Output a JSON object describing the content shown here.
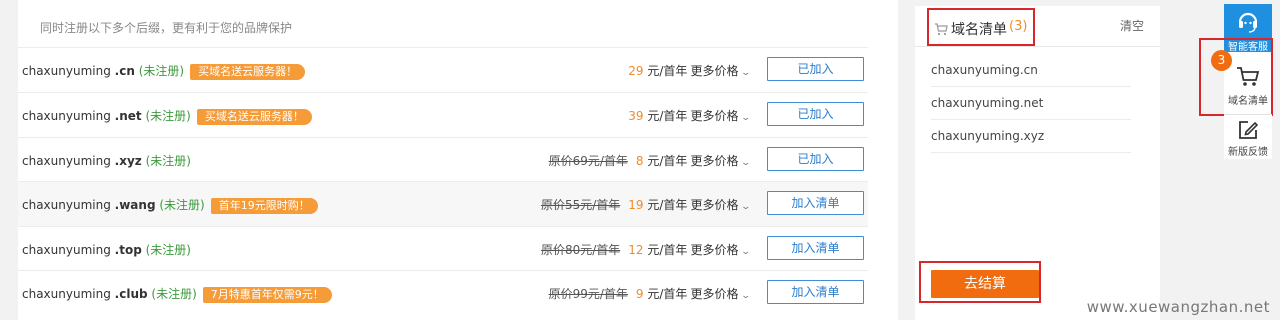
{
  "hint": "同时注册以下多个后缀，更有利于您的品牌保护",
  "rows": [
    {
      "name": "chaxunyuming",
      "ext": ".cn",
      "status": "(未注册)",
      "promo": "买域名送云服务器！",
      "orig": "",
      "price": "29",
      "unit": "元/首年",
      "more": "更多价格",
      "button": "已加入"
    },
    {
      "name": "chaxunyuming",
      "ext": ".net",
      "status": "(未注册)",
      "promo": "买域名送云服务器！",
      "orig": "",
      "price": "39",
      "unit": "元/首年",
      "more": "更多价格",
      "button": "已加入"
    },
    {
      "name": "chaxunyuming",
      "ext": ".xyz",
      "status": "(未注册)",
      "promo": "",
      "orig": "原价69元/首年",
      "price": "8",
      "unit": "元/首年",
      "more": "更多价格",
      "button": "已加入"
    },
    {
      "name": "chaxunyuming",
      "ext": ".wang",
      "status": "(未注册)",
      "promo": "首年19元限时购！",
      "orig": "原价55元/首年",
      "price": "19",
      "unit": "元/首年",
      "more": "更多价格",
      "button": "加入清单"
    },
    {
      "name": "chaxunyuming",
      "ext": ".top",
      "status": "(未注册)",
      "promo": "",
      "orig": "原价80元/首年",
      "price": "12",
      "unit": "元/首年",
      "more": "更多价格",
      "button": "加入清单"
    },
    {
      "name": "chaxunyuming",
      "ext": ".club",
      "status": "(未注册)",
      "promo": "7月特惠首年仅需9元！",
      "orig": "原价99元/首年",
      "price": "9",
      "unit": "元/首年",
      "more": "更多价格",
      "button": "加入清单"
    }
  ],
  "cart": {
    "title": "域名清单",
    "count": "(3)",
    "clear": "清空",
    "items": [
      "chaxunyuming.cn",
      "chaxunyuming.net",
      "chaxunyuming.xyz"
    ],
    "checkout": "去结算"
  },
  "sidebar": {
    "service": "智能客服",
    "cart_badge": "3",
    "cart_label": "域名清单",
    "feedback": "新版反馈"
  },
  "watermark": "www.xuewangzhan.net",
  "colors": {
    "accent_orange": "#f06c0f",
    "price_orange": "#f08c2a",
    "promo_tag": "#f59b38",
    "button_blue": "#3f8fd8",
    "status_green": "#3d9a3d",
    "highlight_red": "#d8262d",
    "service_blue": "#1f8fe0"
  }
}
